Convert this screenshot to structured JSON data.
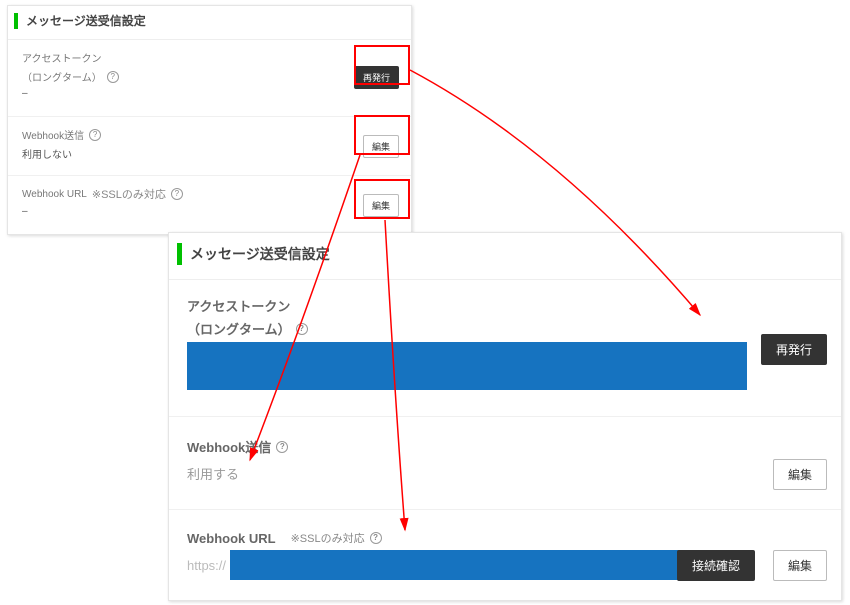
{
  "header_title": "メッセージ送受信設定",
  "small": {
    "token_label_line1": "アクセストークン",
    "token_label_line2": "（ロングターム）",
    "token_value": "–",
    "reissue_label": "再発行",
    "webhook_send_label": "Webhook送信",
    "webhook_send_value": "利用しない",
    "webhook_url_label": "Webhook URL",
    "ssl_note": "※SSLのみ対応",
    "webhook_url_value": "–",
    "edit_label": "編集"
  },
  "large": {
    "token_label_line1": "アクセストークン",
    "token_label_line2": "（ロングターム）",
    "reissue_label": "再発行",
    "webhook_send_label": "Webhook送信",
    "webhook_send_value": "利用する",
    "edit_label": "編集",
    "webhook_url_label": "Webhook URL",
    "ssl_note": "※SSLのみ対応",
    "url_prefix": "https://",
    "verify_label": "接続確認"
  }
}
